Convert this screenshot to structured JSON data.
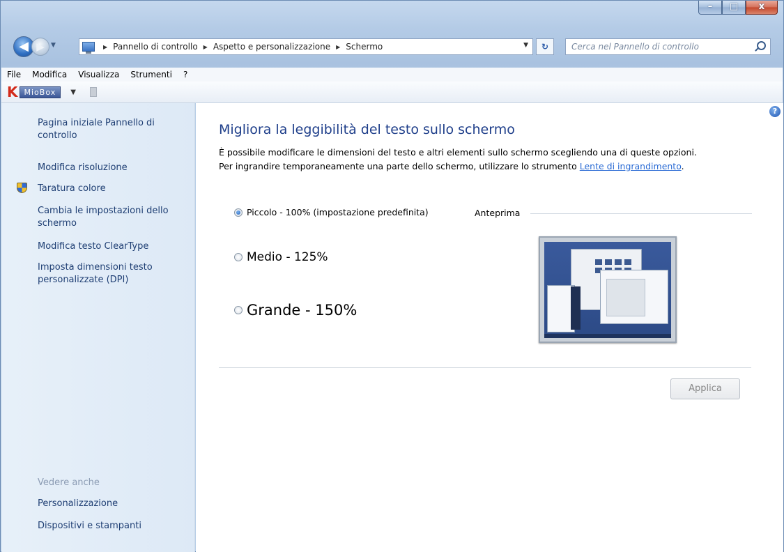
{
  "window": {
    "controls": {
      "minimize": "–",
      "maximize": "□",
      "close": "x"
    }
  },
  "navigation": {
    "breadcrumbs": [
      "Pannello di controllo",
      "Aspetto e personalizzazione",
      "Schermo"
    ],
    "search_placeholder": "Cerca nel Pannello di controllo",
    "icons": [
      "back-arrow-icon",
      "forward-arrow-icon",
      "control-panel-icon",
      "refresh-icon",
      "search-icon"
    ]
  },
  "menubar": [
    "File",
    "Modifica",
    "Visualizza",
    "Strumenti",
    "?"
  ],
  "toolbar": {
    "logo": "K",
    "label": "MioBox"
  },
  "sidebar": {
    "links": [
      "Pagina iniziale Pannello di controllo",
      "Modifica risoluzione",
      "Taratura colore",
      "Cambia le impostazioni dello schermo",
      "Modifica testo ClearType",
      "Imposta dimensioni testo personalizzate (DPI)"
    ],
    "see_also_title": "Vedere anche",
    "see_also_links": [
      "Personalizzazione",
      "Dispositivi e stampanti"
    ]
  },
  "main": {
    "title": "Migliora la leggibilità del testo sullo schermo",
    "description_line1": "È possibile modificare le dimensioni del testo e altri elementi sullo schermo scegliendo una di queste opzioni.",
    "description_line2_pre": "Per ingrandire temporaneamente una parte dello schermo, utilizzare lo strumento ",
    "description_link": "Lente di ingrandimento",
    "description_line2_post": ".",
    "options": [
      {
        "label": "Piccolo - 100% (impostazione predefinita)",
        "selected": true
      },
      {
        "label": "Medio - 125%",
        "selected": false
      },
      {
        "label": "Grande - 150%",
        "selected": false
      }
    ],
    "preview_label": "Anteprima",
    "apply_label": "Applica",
    "help": "?"
  },
  "colors": {
    "title": "#1e3e8a",
    "link": "#2a6bd4",
    "sidebar_link": "#1e3e73"
  }
}
